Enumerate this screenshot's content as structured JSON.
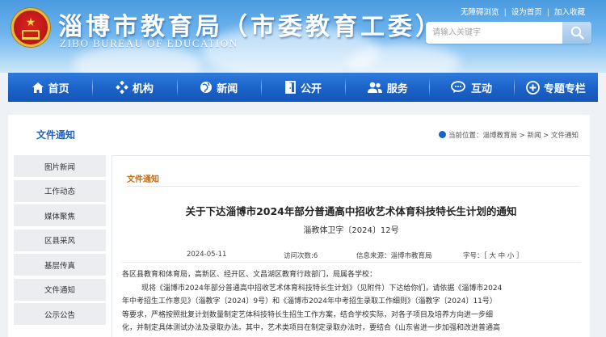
{
  "header": {
    "title": "淄博市教育局（市委教育工委）",
    "subtitle": "ZIBO BUREAU OF EDUCATION",
    "top_links": [
      "无障碍浏览",
      "设为首页",
      "加入收藏"
    ],
    "search_placeholder": "请输入关键字",
    "colors": {
      "banner": "#5aa8e8",
      "emblem_red": "#c0181a",
      "emblem_gold": "#e9b93a"
    }
  },
  "nav": {
    "items": [
      {
        "label": "首页",
        "icon": "home-icon"
      },
      {
        "label": "机构",
        "icon": "diamond-grid-icon"
      },
      {
        "label": "新闻",
        "icon": "globe-icon"
      },
      {
        "label": "公开",
        "icon": "door-icon"
      },
      {
        "label": "服务",
        "icon": "users-icon"
      },
      {
        "label": "互动",
        "icon": "chat-icon"
      },
      {
        "label": "专题专栏",
        "icon": "plus-circle-icon"
      }
    ],
    "color": "#1b62c8"
  },
  "section": {
    "title": "文件通知",
    "breadcrumb": "当前位置：淄博教育局 > 新闻 > 文件通知"
  },
  "sidebar": {
    "items": [
      "图片新闻",
      "工作动态",
      "媒体聚焦",
      "区县采风",
      "基层传真",
      "文件通知",
      "公示公告"
    ]
  },
  "article": {
    "label": "文件通知",
    "title": "关于下达淄博市2024年部分普通高中招收艺术体育科技特长生计划的通知",
    "doc_number": "淄教体卫字〔2024〕12号",
    "meta": {
      "date": "2024-05-11",
      "views": "访问次数:6",
      "source": "信息来源：淄博市教育局",
      "font_size": "字号：［ 大 中 小 ］"
    },
    "paragraphs": [
      "各区县教育和体育局，高新区、经开区、文昌湖区教育行政部门，局属各学校：",
      "现将《淄博市2024年部分普通高中招收艺术体育科技特长生计划》（见附件）下达给你们，请依据《淄博市2024",
      "年中考招生工作意见》（淄教字〔2024〕9号）和《淄博市2024年中考招生录取工作细则》（淄教字〔2024〕11号）",
      "等要求，严格按照批复计划数量制定艺体科技特长生招生工作方案，结合学校实际，对各子项目及培养方向进一步细",
      "化，并制定具体测试办法及录取办法。其中，艺术类项目在制定录取办法时，要结合《山东省进一步加强和改进普通高"
    ]
  }
}
